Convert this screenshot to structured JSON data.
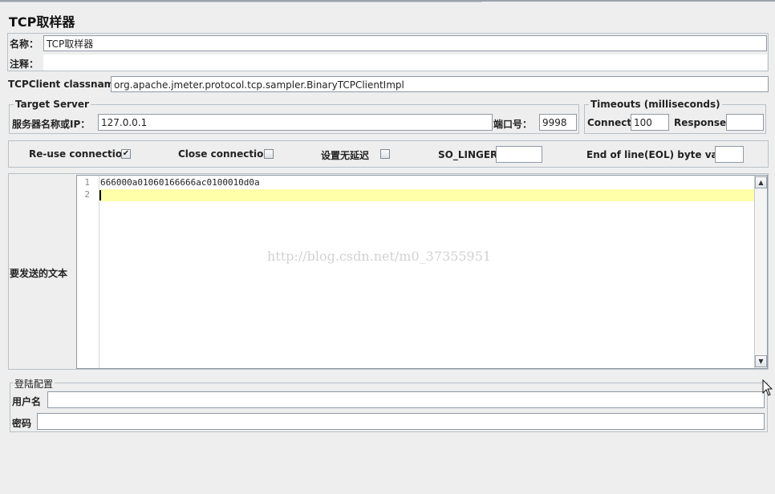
{
  "page_title": "TCP取样器",
  "name_field": {
    "label": "名称：",
    "value": "TCP取样器"
  },
  "comment_field": {
    "label": "注释：",
    "value": ""
  },
  "classname_field": {
    "label": "TCPClient classname:",
    "value": "org.apache.jmeter.protocol.tcp.sampler.BinaryTCPClientImpl"
  },
  "target_server": {
    "legend": "Target Server",
    "host_label": "服务器名称或IP：",
    "host_value": "127.0.0.1",
    "port_label": "端口号：",
    "port_value": "9998"
  },
  "timeouts": {
    "legend": "Timeouts (milliseconds)",
    "connect_label": "Connect:",
    "connect_value": "100",
    "response_label": "Response:",
    "response_value": ""
  },
  "options": {
    "reuse_label": "Re-use connection",
    "reuse_checked": "✔",
    "close_label": "Close connection",
    "nodelay_label": "设置无延迟",
    "solinger_label": "SO_LINGER:",
    "solinger_value": "",
    "eol_label": "End of line(EOL) byte value:",
    "eol_value": ""
  },
  "text_to_send": {
    "label": "要发送的文本",
    "lines": [
      {
        "num": "1",
        "text": "666000a01060166666ac0100010d0a"
      },
      {
        "num": "2",
        "text": ""
      }
    ],
    "scroll_up": "▲",
    "scroll_down": "▼"
  },
  "watermark": "http://blog.csdn.net/m0_37355951",
  "login_config": {
    "legend": "登陆配置",
    "username_label": "用户名",
    "username_value": "",
    "password_label": "密码",
    "password_value": ""
  }
}
